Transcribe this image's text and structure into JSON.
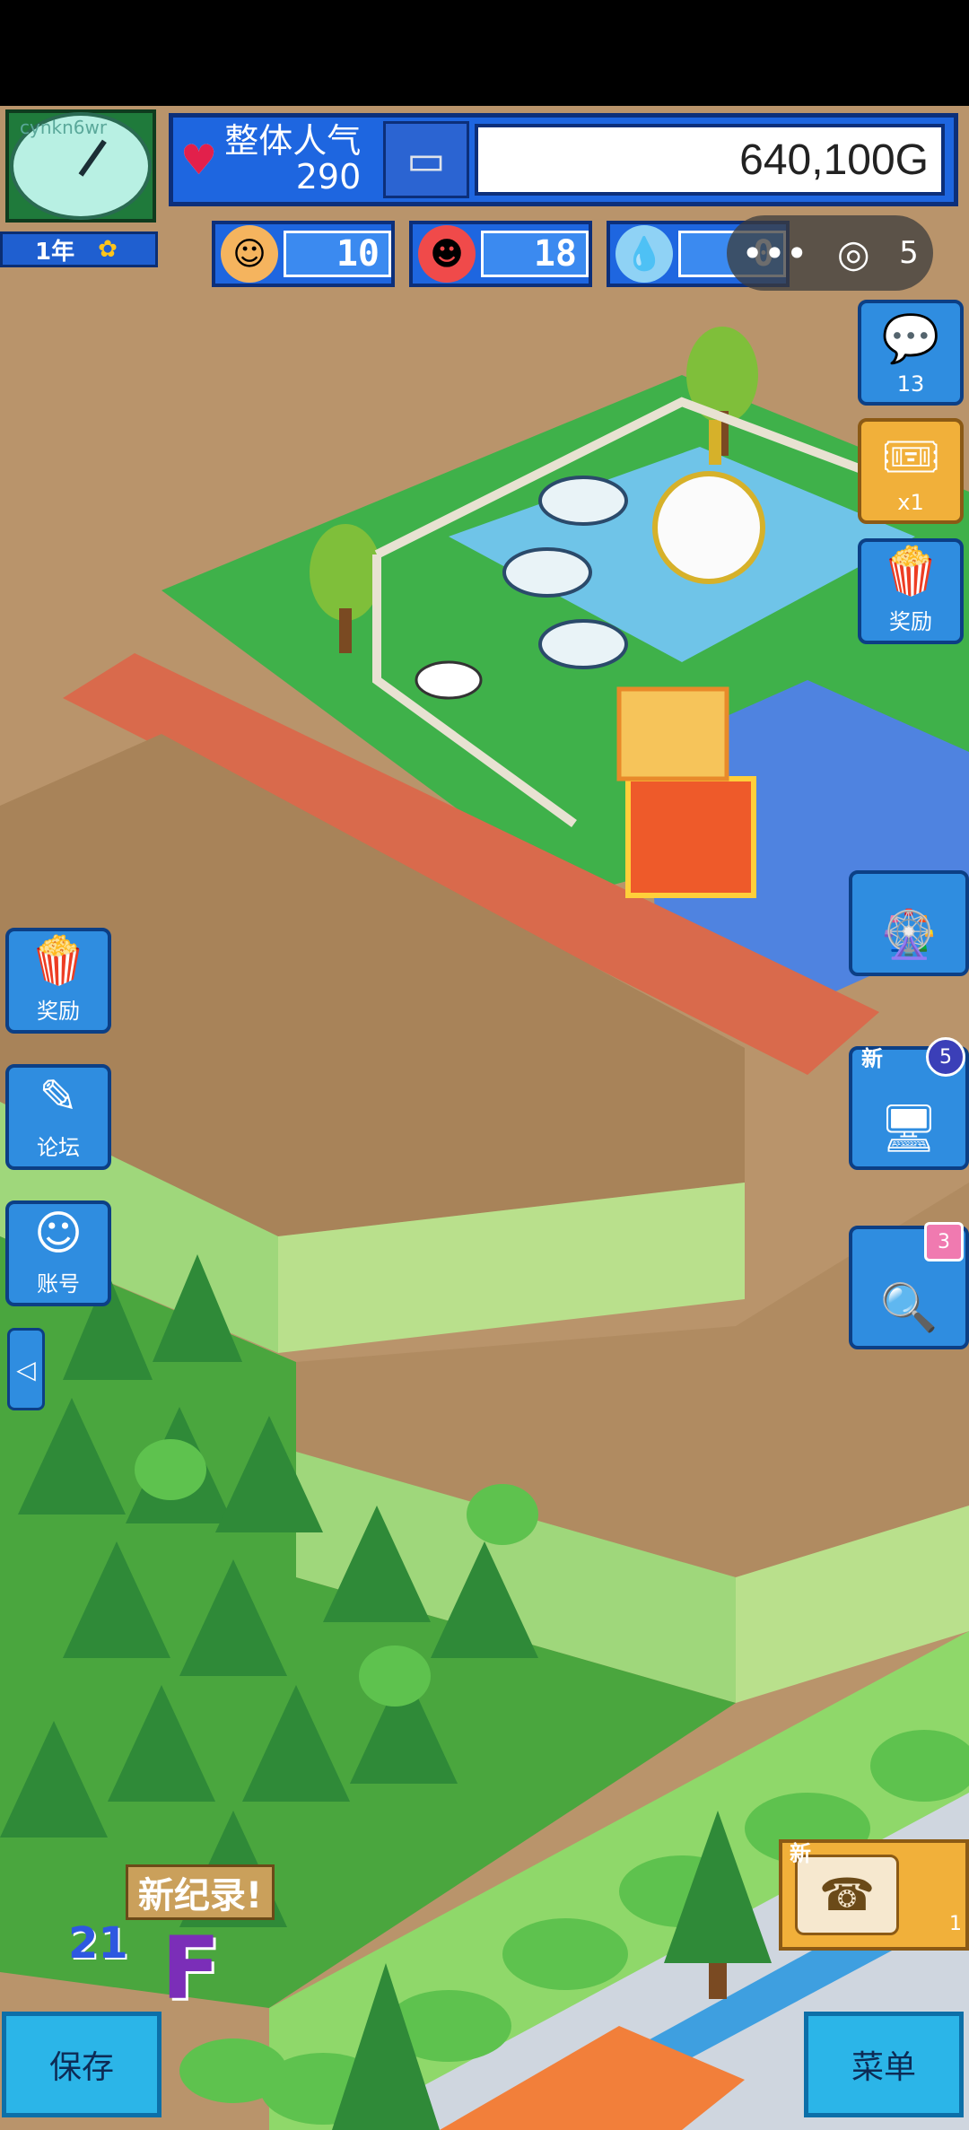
{
  "hud": {
    "watermark": "cynkn6wr",
    "year": "1年",
    "popularity_label": "整体人气",
    "popularity_value": "290",
    "money": "640,100G",
    "resource_1": "10",
    "resource_2": "18",
    "resource_3": "0",
    "resource_3_hidden": "5"
  },
  "side_right": {
    "tasks_count": "13",
    "ticket_count": "x1",
    "reward_label": "奖励",
    "new_label": "新",
    "computer_badge": "5",
    "search_badge": "3"
  },
  "side_left": {
    "reward_label": "奖励",
    "forum_label": "论坛",
    "account_label": "账号"
  },
  "bottom": {
    "save_label": "保存",
    "menu_label": "菜单",
    "record_label": "新纪录!",
    "rank_number": "21",
    "rank_letter": "F",
    "phone_new": "新",
    "phone_count": "1"
  },
  "colors": {
    "hud_blue": "#1e66e0",
    "dirt": "#b9946b",
    "grass": "#49b84a",
    "brick": "#d96a4c",
    "fence_green": "#b9e08c"
  }
}
